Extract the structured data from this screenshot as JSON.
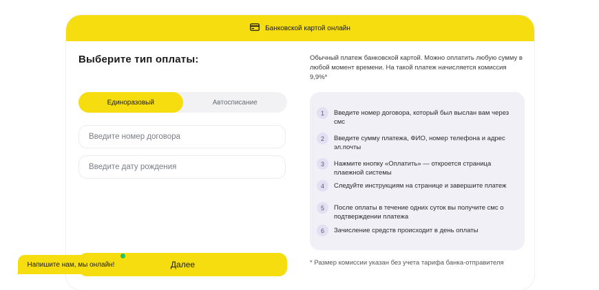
{
  "header": {
    "title": "Банковской картой онлайн",
    "icon": "credit-card-icon"
  },
  "form": {
    "title": "Выберите тип оплаты:",
    "tabs": [
      {
        "label": "Единоразовый",
        "active": true
      },
      {
        "label": "Автосписание",
        "active": false
      }
    ],
    "contract_placeholder": "Введите номер договора",
    "birthdate_placeholder": "Введите дату рождения",
    "next_label": "Далее"
  },
  "info": {
    "description": "Обычный платеж банковской картой. Можно оплатить любую сумму в любой момент времени. На такой платеж начисляется комиссия 9,9%*",
    "steps": [
      {
        "num": "1",
        "text": "Введите номер договора, который был выслан вам через смс"
      },
      {
        "num": "2",
        "text": "Введите сумму платежа, ФИО, номер телефона и адрес эл.почты"
      },
      {
        "num": "3",
        "text": "Нажмите кнопку «Оплатить» — откроется страница плаежной системы"
      },
      {
        "num": "4",
        "text": "Следуйте инструкциям на странице и завершите платеж"
      },
      {
        "num": "5",
        "text": "После оплаты в течение одних суток вы получите смс о подтверждении платежа"
      },
      {
        "num": "6",
        "text": "Зачисление средств происходит в день оплаты"
      }
    ],
    "footnote": "* Размер комиссии указан без учета тарифа банка-отправителя"
  },
  "chat": {
    "label": "Напишите нам, мы онлайн!"
  },
  "colors": {
    "accent": "#f6dd0f",
    "steps_bg": "#f1f0f6",
    "online": "#1fc36b"
  }
}
